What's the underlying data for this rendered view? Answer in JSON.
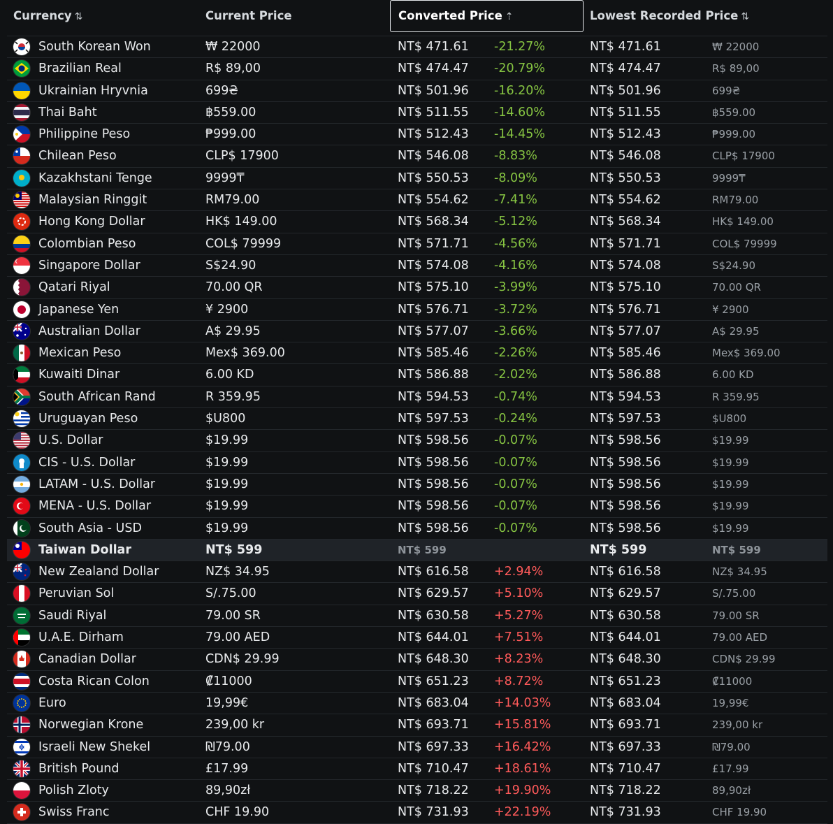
{
  "header": {
    "currency": "Currency",
    "current_price": "Current Price",
    "converted_price": "Converted Price",
    "lowest_recorded": "Lowest Recorded Price",
    "sort_icon": "⇅",
    "sort_active_icon": "⇡"
  },
  "colors": {
    "negative": "#86c442",
    "positive": "#ff5a5a",
    "background": "#101214",
    "highlight": "#1f2328"
  },
  "rows": [
    {
      "flag": "south-korea",
      "name": "South Korean Won",
      "price": "₩ 22000",
      "converted": "NT$ 471.61",
      "diff": "-21.27%",
      "lowest": "NT$ 471.61",
      "lowest_price": "₩ 22000"
    },
    {
      "flag": "brazil",
      "name": "Brazilian Real",
      "price": "R$ 89,00",
      "converted": "NT$ 474.47",
      "diff": "-20.79%",
      "lowest": "NT$ 474.47",
      "lowest_price": "R$ 89,00"
    },
    {
      "flag": "ukraine",
      "name": "Ukrainian Hryvnia",
      "price": "699₴",
      "converted": "NT$ 501.96",
      "diff": "-16.20%",
      "lowest": "NT$ 501.96",
      "lowest_price": "699₴"
    },
    {
      "flag": "thailand",
      "name": "Thai Baht",
      "price": "฿559.00",
      "converted": "NT$ 511.55",
      "diff": "-14.60%",
      "lowest": "NT$ 511.55",
      "lowest_price": "฿559.00"
    },
    {
      "flag": "philippines",
      "name": "Philippine Peso",
      "price": "₱999.00",
      "converted": "NT$ 512.43",
      "diff": "-14.45%",
      "lowest": "NT$ 512.43",
      "lowest_price": "₱999.00"
    },
    {
      "flag": "chile",
      "name": "Chilean Peso",
      "price": "CLP$ 17900",
      "converted": "NT$ 546.08",
      "diff": "-8.83%",
      "lowest": "NT$ 546.08",
      "lowest_price": "CLP$ 17900"
    },
    {
      "flag": "kazakhstan",
      "name": "Kazakhstani Tenge",
      "price": "9999₸",
      "converted": "NT$ 550.53",
      "diff": "-8.09%",
      "lowest": "NT$ 550.53",
      "lowest_price": "9999₸"
    },
    {
      "flag": "malaysia",
      "name": "Malaysian Ringgit",
      "price": "RM79.00",
      "converted": "NT$ 554.62",
      "diff": "-7.41%",
      "lowest": "NT$ 554.62",
      "lowest_price": "RM79.00"
    },
    {
      "flag": "hong-kong",
      "name": "Hong Kong Dollar",
      "price": "HK$ 149.00",
      "converted": "NT$ 568.34",
      "diff": "-5.12%",
      "lowest": "NT$ 568.34",
      "lowest_price": "HK$ 149.00"
    },
    {
      "flag": "colombia",
      "name": "Colombian Peso",
      "price": "COL$ 79999",
      "converted": "NT$ 571.71",
      "diff": "-4.56%",
      "lowest": "NT$ 571.71",
      "lowest_price": "COL$ 79999"
    },
    {
      "flag": "singapore",
      "name": "Singapore Dollar",
      "price": "S$24.90",
      "converted": "NT$ 574.08",
      "diff": "-4.16%",
      "lowest": "NT$ 574.08",
      "lowest_price": "S$24.90"
    },
    {
      "flag": "qatar",
      "name": "Qatari Riyal",
      "price": "70.00 QR",
      "converted": "NT$ 575.10",
      "diff": "-3.99%",
      "lowest": "NT$ 575.10",
      "lowest_price": "70.00 QR"
    },
    {
      "flag": "japan",
      "name": "Japanese Yen",
      "price": "¥ 2900",
      "converted": "NT$ 576.71",
      "diff": "-3.72%",
      "lowest": "NT$ 576.71",
      "lowest_price": "¥ 2900"
    },
    {
      "flag": "australia",
      "name": "Australian Dollar",
      "price": "A$ 29.95",
      "converted": "NT$ 577.07",
      "diff": "-3.66%",
      "lowest": "NT$ 577.07",
      "lowest_price": "A$ 29.95"
    },
    {
      "flag": "mexico",
      "name": "Mexican Peso",
      "price": "Mex$ 369.00",
      "converted": "NT$ 585.46",
      "diff": "-2.26%",
      "lowest": "NT$ 585.46",
      "lowest_price": "Mex$ 369.00"
    },
    {
      "flag": "kuwait",
      "name": "Kuwaiti Dinar",
      "price": "6.00 KD",
      "converted": "NT$ 586.88",
      "diff": "-2.02%",
      "lowest": "NT$ 586.88",
      "lowest_price": "6.00 KD"
    },
    {
      "flag": "south-africa",
      "name": "South African Rand",
      "price": "R 359.95",
      "converted": "NT$ 594.53",
      "diff": "-0.74%",
      "lowest": "NT$ 594.53",
      "lowest_price": "R 359.95"
    },
    {
      "flag": "uruguay",
      "name": "Uruguayan Peso",
      "price": "$U800",
      "converted": "NT$ 597.53",
      "diff": "-0.24%",
      "lowest": "NT$ 597.53",
      "lowest_price": "$U800"
    },
    {
      "flag": "usa",
      "name": "U.S. Dollar",
      "price": "$19.99",
      "converted": "NT$ 598.56",
      "diff": "-0.07%",
      "lowest": "NT$ 598.56",
      "lowest_price": "$19.99"
    },
    {
      "flag": "cis",
      "name": "CIS - U.S. Dollar",
      "price": "$19.99",
      "converted": "NT$ 598.56",
      "diff": "-0.07%",
      "lowest": "NT$ 598.56",
      "lowest_price": "$19.99"
    },
    {
      "flag": "latam",
      "name": "LATAM - U.S. Dollar",
      "price": "$19.99",
      "converted": "NT$ 598.56",
      "diff": "-0.07%",
      "lowest": "NT$ 598.56",
      "lowest_price": "$19.99"
    },
    {
      "flag": "mena",
      "name": "MENA - U.S. Dollar",
      "price": "$19.99",
      "converted": "NT$ 598.56",
      "diff": "-0.07%",
      "lowest": "NT$ 598.56",
      "lowest_price": "$19.99"
    },
    {
      "flag": "south-asia",
      "name": "South Asia - USD",
      "price": "$19.99",
      "converted": "NT$ 598.56",
      "diff": "-0.07%",
      "lowest": "NT$ 598.56",
      "lowest_price": "$19.99"
    },
    {
      "flag": "taiwan",
      "name": "Taiwan Dollar",
      "price": "NT$ 599",
      "converted": "NT$ 599",
      "diff": "",
      "lowest": "NT$ 599",
      "lowest_price": "NT$ 599",
      "highlight": true
    },
    {
      "flag": "new-zealand",
      "name": "New Zealand Dollar",
      "price": "NZ$ 34.95",
      "converted": "NT$ 616.58",
      "diff": "+2.94%",
      "lowest": "NT$ 616.58",
      "lowest_price": "NZ$ 34.95"
    },
    {
      "flag": "peru",
      "name": "Peruvian Sol",
      "price": "S/.75.00",
      "converted": "NT$ 629.57",
      "diff": "+5.10%",
      "lowest": "NT$ 629.57",
      "lowest_price": "S/.75.00"
    },
    {
      "flag": "saudi-arabia",
      "name": "Saudi Riyal",
      "price": "79.00 SR",
      "converted": "NT$ 630.58",
      "diff": "+5.27%",
      "lowest": "NT$ 630.58",
      "lowest_price": "79.00 SR"
    },
    {
      "flag": "uae",
      "name": "U.A.E. Dirham",
      "price": "79.00 AED",
      "converted": "NT$ 644.01",
      "diff": "+7.51%",
      "lowest": "NT$ 644.01",
      "lowest_price": "79.00 AED"
    },
    {
      "flag": "canada",
      "name": "Canadian Dollar",
      "price": "CDN$ 29.99",
      "converted": "NT$ 648.30",
      "diff": "+8.23%",
      "lowest": "NT$ 648.30",
      "lowest_price": "CDN$ 29.99"
    },
    {
      "flag": "costa-rica",
      "name": "Costa Rican Colon",
      "price": "₡11000",
      "converted": "NT$ 651.23",
      "diff": "+8.72%",
      "lowest": "NT$ 651.23",
      "lowest_price": "₡11000"
    },
    {
      "flag": "eu",
      "name": "Euro",
      "price": "19,99€",
      "converted": "NT$ 683.04",
      "diff": "+14.03%",
      "lowest": "NT$ 683.04",
      "lowest_price": "19,99€"
    },
    {
      "flag": "norway",
      "name": "Norwegian Krone",
      "price": "239,00 kr",
      "converted": "NT$ 693.71",
      "diff": "+15.81%",
      "lowest": "NT$ 693.71",
      "lowest_price": "239,00 kr"
    },
    {
      "flag": "israel",
      "name": "Israeli New Shekel",
      "price": "₪79.00",
      "converted": "NT$ 697.33",
      "diff": "+16.42%",
      "lowest": "NT$ 697.33",
      "lowest_price": "₪79.00"
    },
    {
      "flag": "uk",
      "name": "British Pound",
      "price": "£17.99",
      "converted": "NT$ 710.47",
      "diff": "+18.61%",
      "lowest": "NT$ 710.47",
      "lowest_price": "£17.99"
    },
    {
      "flag": "poland",
      "name": "Polish Zloty",
      "price": "89,90zł",
      "converted": "NT$ 718.22",
      "diff": "+19.90%",
      "lowest": "NT$ 718.22",
      "lowest_price": "89,90zł"
    },
    {
      "flag": "switzerland",
      "name": "Swiss Franc",
      "price": "CHF 19.90",
      "converted": "NT$ 731.93",
      "diff": "+22.19%",
      "lowest": "NT$ 731.93",
      "lowest_price": "CHF 19.90"
    }
  ]
}
